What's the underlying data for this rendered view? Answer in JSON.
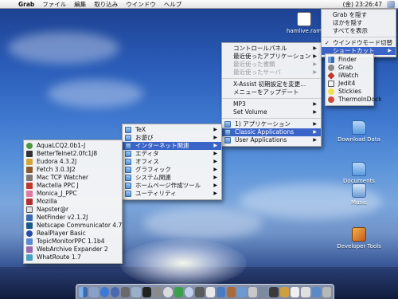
{
  "menubar": {
    "apple_glyph": "",
    "items": [
      "Grab",
      "ファイル",
      "編集",
      "取り込み",
      "ウインドウ",
      "ヘルプ"
    ],
    "clock": "(金) 23:26:47"
  },
  "apple_menu": {
    "items": [
      {
        "label": "コントロールパネル",
        "submenu": true
      },
      {
        "label": "最近使ったアプリケーション",
        "submenu": true
      },
      {
        "label": "最近使った書類",
        "submenu": true,
        "disabled": true
      },
      {
        "label": "最近使ったサーバ",
        "submenu": true,
        "disabled": true
      },
      {
        "label": "X-Assist 初期設定を変更..."
      },
      {
        "label": "メニューをアップデート"
      },
      {
        "label": "MP3",
        "submenu": true
      },
      {
        "label": "Set Volume",
        "submenu": true
      },
      {
        "label": "1) アプリケーション",
        "submenu": true
      },
      {
        "label": "Classic Applications",
        "submenu": true
      },
      {
        "label": "User Applications",
        "submenu": true
      }
    ]
  },
  "classic_menu": {
    "items": [
      "TeX",
      "お遊び",
      "インターネット関連",
      "エディタ",
      "オフィス",
      "グラフィック",
      "システム関連",
      "ホームページ作成ツール",
      "ユーティリティ"
    ]
  },
  "internet_menu": {
    "items": [
      "AquaLCQ2.0b1-J",
      "BetterTelnet2.0fc1J8",
      "Eudora 4.3.2J",
      "Fetch 3.0.3J2",
      "Mac TCP Watcher",
      "Mactella PPC J",
      "Monica_J_PPC",
      "Mozilla",
      "Napster@r",
      "NetFinder v2.1.2J",
      "Netscape Communicator 4.7",
      "RealPlayer Basic",
      "TopicMonitorPPC 1.1b4",
      "WebArchive Expander 2",
      "WhatRoute 1.7"
    ]
  },
  "app_menu": {
    "items": [
      {
        "label": "Grab を隠す"
      },
      {
        "label": "ほかを隠す"
      },
      {
        "label": "すべてを表示"
      },
      {
        "label": "ウインドウモード切替",
        "checked": true
      },
      {
        "label": "ショートカット",
        "submenu": true
      }
    ]
  },
  "shortcut_menu": {
    "items": [
      "Finder",
      "Grab",
      "iWatch",
      "Jedit4",
      "Stickies",
      "ThermoInDock"
    ]
  },
  "desktop": {
    "icons": [
      "hamlive.ram",
      "Download Data",
      "Documents",
      "Music",
      "Developer Tools"
    ]
  }
}
